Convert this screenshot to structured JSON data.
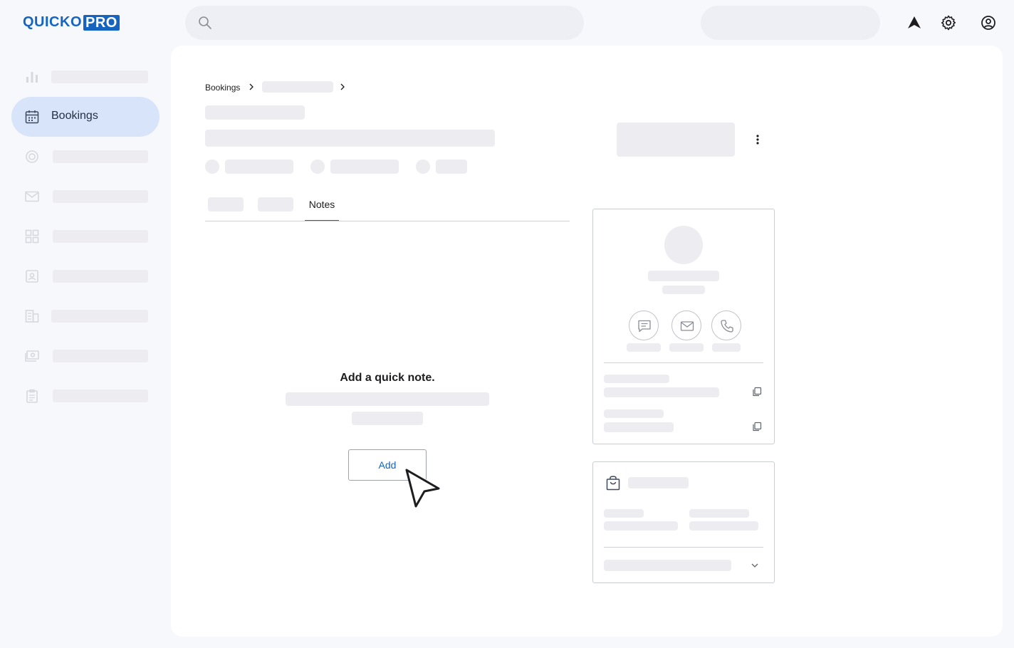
{
  "brand": {
    "logo_left": "QUICKO",
    "logo_right": "PRO"
  },
  "sidebar": {
    "active_label": "Bookings"
  },
  "breadcrumb": {
    "root": "Bookings"
  },
  "tabs": {
    "active_label": "Notes"
  },
  "notes": {
    "empty_title": "Add a quick note.",
    "add_label": "Add"
  },
  "colors": {
    "accent": "#1565c0",
    "active_bg": "#d7e4fa",
    "skeleton": "#ececf1"
  }
}
